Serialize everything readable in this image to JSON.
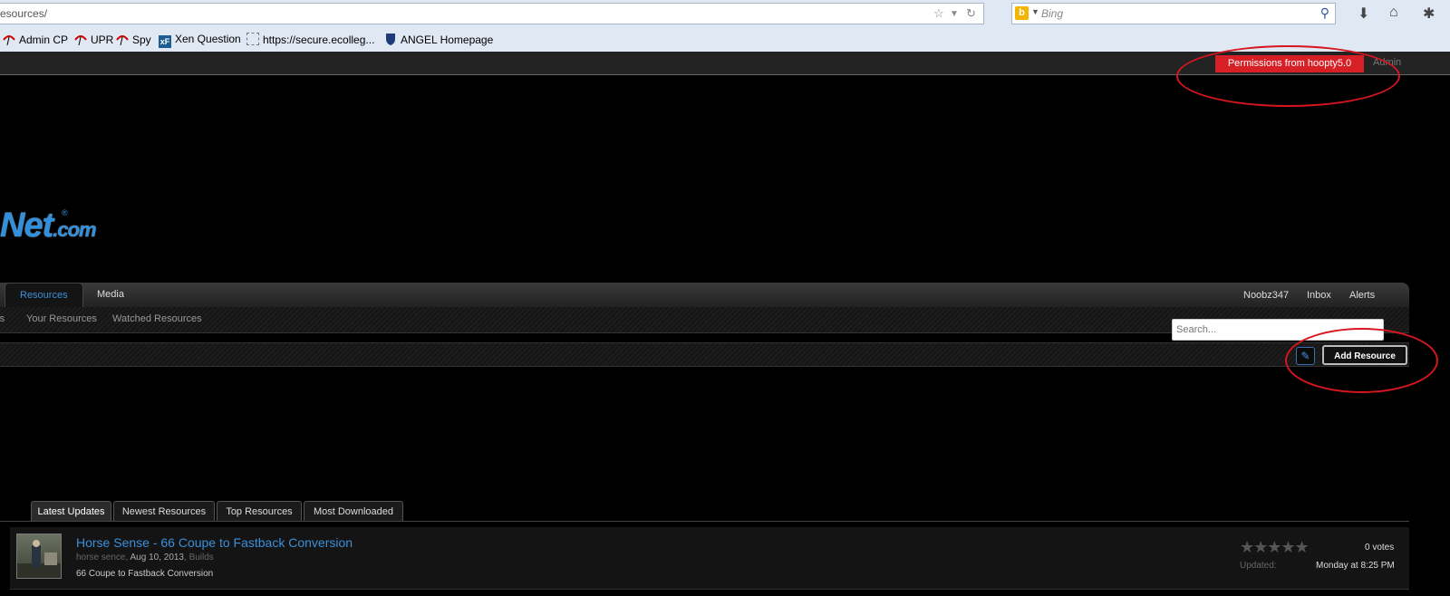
{
  "browser": {
    "url": "esources/",
    "search_engine": "Bing",
    "bookmarks": [
      {
        "label": "Admin CP"
      },
      {
        "label": "UPR"
      },
      {
        "label": "Spy"
      },
      {
        "label": "Xen Question",
        "icon_text": "xF"
      },
      {
        "label": "https://secure.ecolleg..."
      },
      {
        "label": "ANGEL Homepage"
      }
    ]
  },
  "admin_bar": {
    "permissions_badge": "Permissions from hoopty5.0",
    "admin_link": "Admin"
  },
  "logo": {
    "text": "Net",
    "suffix": ".com",
    "mark": "®"
  },
  "nav": {
    "tabs": [
      "Resources",
      "Media"
    ],
    "user_links": [
      "Noobz347",
      "Inbox",
      "Alerts"
    ],
    "subnav": [
      "rs",
      "Your Resources",
      "Watched Resources"
    ],
    "search_placeholder": "Search..."
  },
  "title_bar": {
    "add_resource_label": "Add Resource"
  },
  "resource_tabs": [
    "Latest Updates",
    "Newest Resources",
    "Top Resources",
    "Most Downloaded"
  ],
  "resources": [
    {
      "title": "Horse Sense - 66 Coupe to Fastback Conversion",
      "author": "horse sence",
      "date": "Aug 10, 2013",
      "category": "Builds",
      "description": "66 Coupe to Fastback Conversion",
      "stars": "★★★★★",
      "rating": 0,
      "votes": "0 votes",
      "updated_label": "Updated:",
      "updated_time": "Monday at 8:25 PM"
    }
  ],
  "colors": {
    "accent": "#3b8fd8",
    "annotation": "#d7161f",
    "badge": "#d71f26"
  }
}
